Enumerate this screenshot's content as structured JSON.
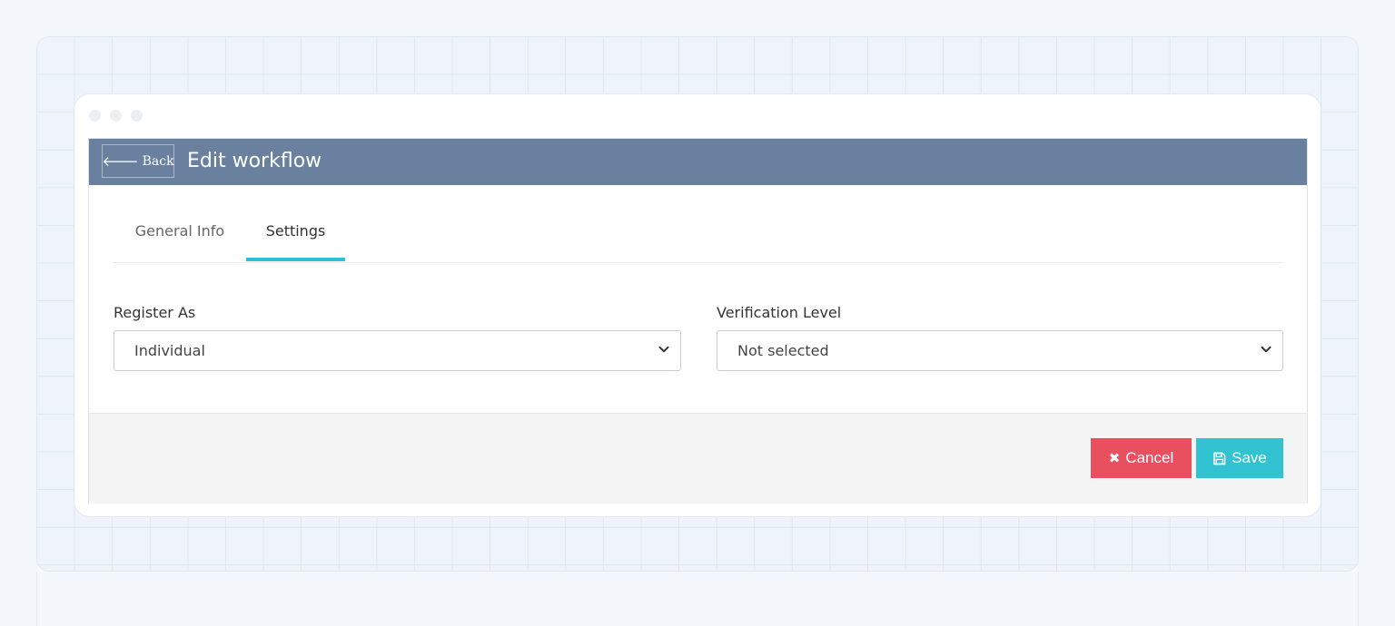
{
  "header": {
    "back_label": "Back",
    "back_icon": "arrow-left-icon",
    "title": "Edit workflow"
  },
  "tabs": [
    {
      "label": "General Info",
      "active": false
    },
    {
      "label": "Settings",
      "active": true
    }
  ],
  "form": {
    "register_as": {
      "label": "Register As",
      "value": "Individual"
    },
    "verification_level": {
      "label": "Verification Level",
      "value": "Not selected"
    }
  },
  "footer": {
    "cancel_label": "Cancel",
    "cancel_icon": "times-icon",
    "save_label": "Save",
    "save_icon": "floppy-disk-icon"
  },
  "colors": {
    "header_bg": "#69809f",
    "tab_active": "#2fc0d1",
    "cancel": "#e8505f",
    "save": "#32c2d2"
  }
}
